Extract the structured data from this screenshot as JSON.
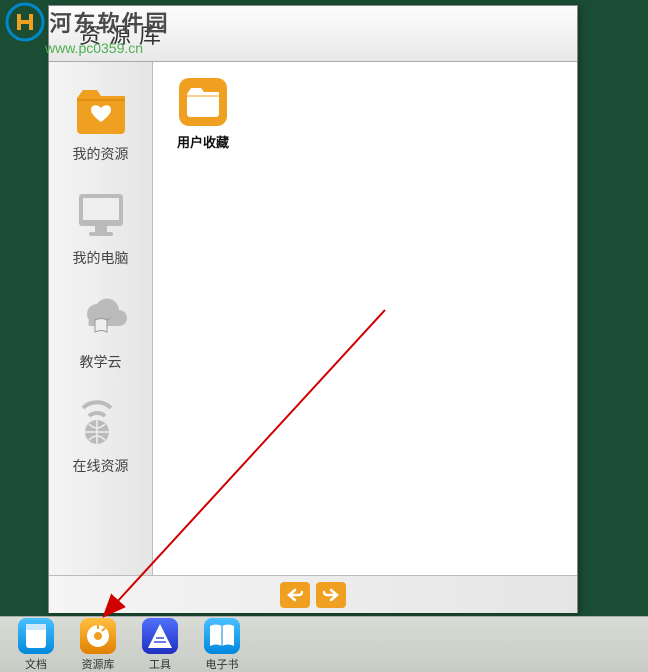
{
  "watermark": {
    "text": "河东软件园",
    "url": "www.pc0359.cn"
  },
  "panel": {
    "title": "资源库"
  },
  "sidebar": {
    "items": [
      {
        "label": "我的资源",
        "icon": "folder-heart",
        "active": true
      },
      {
        "label": "我的电脑",
        "icon": "monitor",
        "active": false
      },
      {
        "label": "教学云",
        "icon": "cloud-book",
        "active": false
      },
      {
        "label": "在线资源",
        "icon": "globe-signal",
        "active": false
      }
    ]
  },
  "content": {
    "folders": [
      {
        "label": "用户收藏",
        "icon": "folder"
      }
    ]
  },
  "footer": {
    "back": "back",
    "forward": "forward"
  },
  "toolbar": {
    "items": [
      {
        "label": "文档",
        "color": "#0099ff",
        "icon": "document"
      },
      {
        "label": "资源库",
        "color": "#f0a020",
        "icon": "library"
      },
      {
        "label": "工具",
        "color": "#3450e0",
        "icon": "tools"
      },
      {
        "label": "电子书",
        "color": "#0099ff",
        "icon": "book"
      }
    ]
  }
}
